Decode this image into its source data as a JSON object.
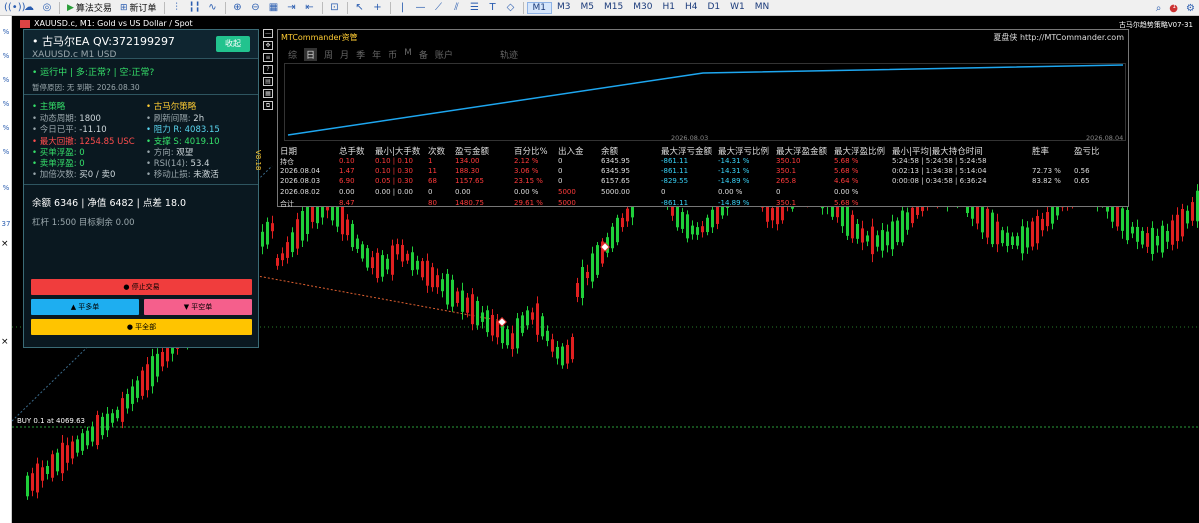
{
  "toolbar": {
    "algo_trade": "算法交易",
    "new_order": "新订单",
    "timeframes": [
      "M1",
      "M3",
      "M5",
      "M15",
      "M30",
      "H1",
      "H4",
      "D1",
      "W1",
      "MN"
    ],
    "active_timeframe": "M1",
    "notifications_count": "1"
  },
  "chart": {
    "title": "XAUUSD.c, M1: Gold vs US Dollar / Spot",
    "right_label": "古马尔趋势策略V07-31",
    "buy_label": "BUY 0.1 at 4069.63",
    "left_numbers": [
      "%",
      "%",
      "%",
      "%",
      "%",
      "%",
      "%",
      "37"
    ]
  },
  "ea": {
    "title": "• 古马尔EA  QV:372199297",
    "subtitle": "XAUUSD.c  M1  USD",
    "collapse_button": "收起",
    "status_line": "• 运行中 | 多:正常? | 空:正常?",
    "pause_line": "暂停原因: 无   到期: 2026.08.30",
    "main_strategy": {
      "header": "• 主策略",
      "rows": [
        {
          "label": "动态周期:",
          "value": "1800"
        },
        {
          "label": "今日已平:",
          "value": "-11.10"
        },
        {
          "label": "最大回撤:",
          "value": "1254.85 USC"
        },
        {
          "label": "买单浮盈:",
          "value": "0"
        },
        {
          "label": "卖单浮盈:",
          "value": "0"
        },
        {
          "label": "加倍次数:",
          "value": "买0 / 卖0"
        }
      ]
    },
    "gumar_strategy": {
      "header": "• 古马尔策略",
      "rows": [
        {
          "label": "刷新间隔:",
          "value": "2h"
        },
        {
          "label": "阻力 R:",
          "value": "4083.15"
        },
        {
          "label": "支撑 S:",
          "value": "4019.10"
        },
        {
          "label": "方向:",
          "value": "观望"
        },
        {
          "label": "RSI(14):",
          "value": "53.4"
        },
        {
          "label": "移动止损:",
          "value": "未激活"
        }
      ]
    },
    "balance_line": "余额 6346 | 净值 6482 | 点差 18.0",
    "leverage_line": "杠杆 1:500      目标剩余 0.00",
    "stop_button": "● 停止交易",
    "close_buy_button": "▲ 平多单",
    "close_sell_button": "▼ 平空单",
    "close_all_button": "● 平全部"
  },
  "mt": {
    "title": "MTCommander资管",
    "right_text": "夏盘侠 http://MTCommander.com",
    "tabs": [
      "综",
      "日",
      "周",
      "月",
      "季",
      "年",
      "币",
      "M",
      "备",
      "账户"
    ],
    "active_tab": "日",
    "trajectory_label": "轨迹",
    "date_left": "2026.08.03",
    "date_right": "2026.08.04",
    "headers": [
      "日期",
      "总手数",
      "最小|大手数",
      "次数",
      "盈亏金额",
      "百分比%",
      "出入金",
      "余额",
      "最大浮亏金额",
      "最大浮亏比例",
      "最大浮盈金额",
      "最大浮盈比例",
      "最小|平均|最大持仓时间",
      "胜率",
      "盈亏比"
    ],
    "rows": [
      [
        "持仓",
        "0.10",
        "0.10 | 0.10",
        "1",
        "134.00",
        "2.12 %",
        "0",
        "6345.95",
        "-861.11",
        "-14.31 %",
        "350.10",
        "5.68 %",
        "5:24:58 | 5:24:58 | 5:24:58",
        "",
        ""
      ],
      [
        "2026.08.04",
        "1.47",
        "0.10 | 0.30",
        "11",
        "188.30",
        "3.06 %",
        "0",
        "6345.95",
        "-861.11",
        "-14.31 %",
        "350.1",
        "5.68 %",
        "0:02:13 | 1:34:38 | 5:14:04",
        "72.73 %",
        "0.56"
      ],
      [
        "2026.08.03",
        "6.90",
        "0.05 | 0.30",
        "68",
        "1157.65",
        "23.15 %",
        "0",
        "6157.65",
        "-829.55",
        "-14.89 %",
        "265.8",
        "4.64 %",
        "0:00:08 | 0:34:58 | 6:36:24",
        "83.82 %",
        "0.65"
      ],
      [
        "2026.08.02",
        "0.00",
        "0.00 | 0.00",
        "0",
        "0.00",
        "0.00 %",
        "5000",
        "5000.00",
        "0",
        "0.00 %",
        "0",
        "0.00 %",
        "",
        "",
        ""
      ],
      [
        "合计",
        "8.47",
        "",
        "80",
        "1480.75",
        "29.61 %",
        "5000",
        "",
        "-861.11",
        "-14.89 %",
        "350.1",
        "5.68 %",
        "",
        "",
        ""
      ]
    ],
    "version_label": "V8.18"
  }
}
